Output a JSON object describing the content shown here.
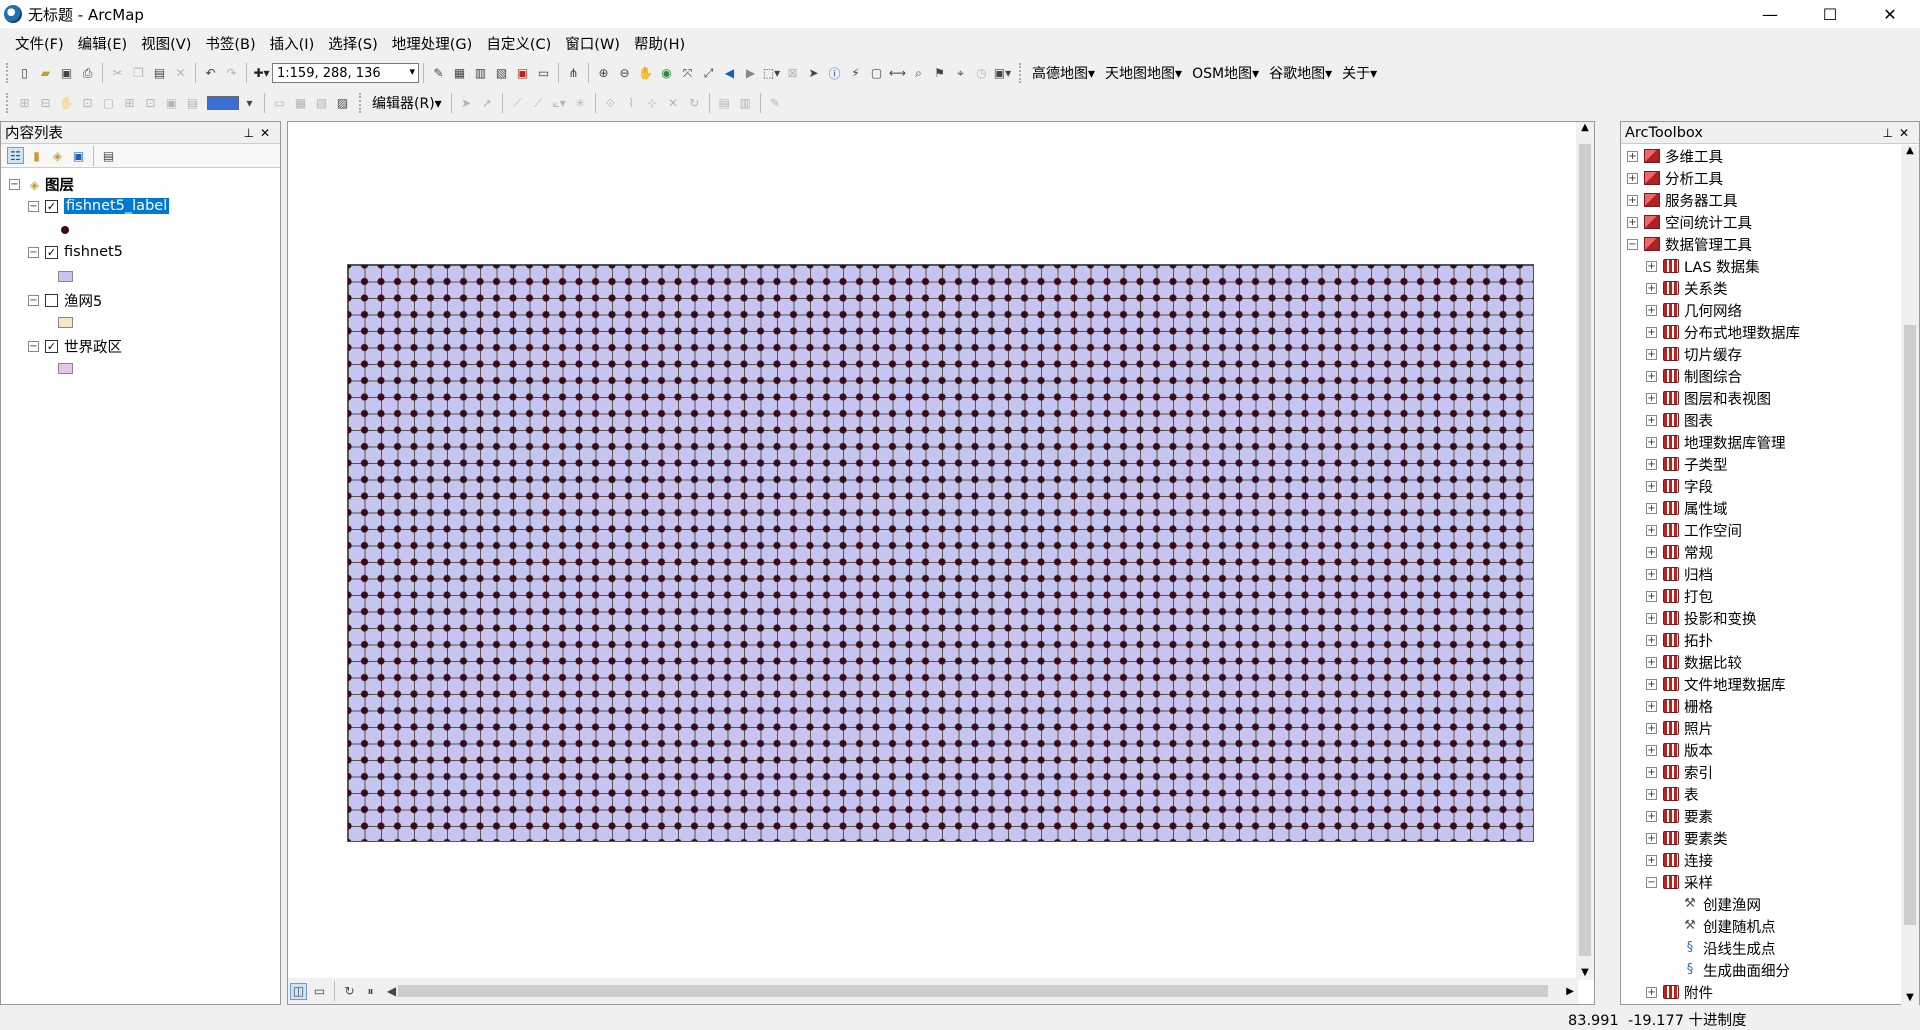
{
  "window": {
    "title": "无标题 - ArcMap"
  },
  "window_controls": {
    "minimize": "—",
    "maximize": "☐",
    "close": "✕"
  },
  "menu": [
    "文件(F)",
    "编辑(E)",
    "视图(V)",
    "书签(B)",
    "插入(I)",
    "选择(S)",
    "地理处理(G)",
    "自定义(C)",
    "窗口(W)",
    "帮助(H)"
  ],
  "toolbar": {
    "scale_value": "1:159, 288, 136",
    "editor_label": "编辑器(R)",
    "basemap_menus": [
      "高德地图",
      "天地图地图",
      "OSM地图",
      "谷歌地图",
      "关于"
    ]
  },
  "toc": {
    "title": "内容列表",
    "root_label": "图层",
    "layers": [
      {
        "name": "fishnet5_label",
        "checked": true,
        "selected": true
      },
      {
        "name": "fishnet5",
        "checked": true,
        "selected": false
      },
      {
        "name": "渔网5",
        "checked": false,
        "selected": false
      },
      {
        "name": "世界政区",
        "checked": true,
        "selected": false
      }
    ]
  },
  "toolbox": {
    "title": "ArcToolbox",
    "items": [
      "多维工具",
      "分析工具",
      "服务器工具",
      "空间统计工具",
      "数据管理工具",
      "LAS 数据集",
      "关系类",
      "几何网络",
      "分布式地理数据库",
      "切片缓存",
      "制图综合",
      "图层和表视图",
      "图表",
      "地理数据库管理",
      "子类型",
      "字段",
      "属性域",
      "工作空间",
      "常规",
      "归档",
      "打包",
      "投影和变换",
      "拓扑",
      "数据比较",
      "文件地理数据库",
      "栅格",
      "照片",
      "版本",
      "索引",
      "表",
      "要素",
      "要素类",
      "连接",
      "采样",
      "创建渔网",
      "创建随机点",
      "沿线生成点",
      "生成曲面细分",
      "附件"
    ]
  },
  "status": {
    "x": "83.991",
    "y": "-19.177",
    "units": "十进制度"
  },
  "colors": {
    "fishnet_fill": "#c5c5ef",
    "point_fill": "#3a0a14",
    "selection": "#0078d7"
  }
}
